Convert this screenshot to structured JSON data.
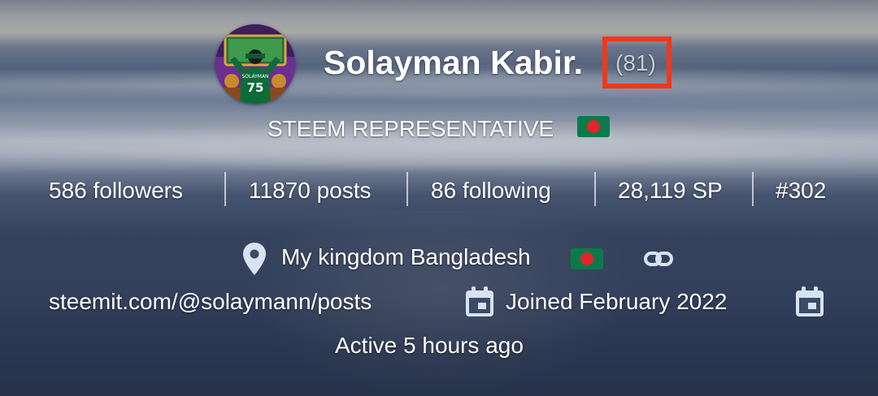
{
  "profile": {
    "name": "Solayman Kabir.",
    "reputation": "(81)",
    "tagline": "STEEM REPRESENTATIVE",
    "avatar_label": "SOLAYMAN",
    "avatar_number": "75"
  },
  "stats": {
    "followers": "586 followers",
    "posts": "11870 posts",
    "following": "86 following",
    "sp": "28,119 SP",
    "rank": "#302"
  },
  "info": {
    "location": "My kingdom Bangladesh",
    "website": "steemit.com/@solaymann/posts",
    "joined": "Joined February 2022",
    "active": "Active 5 hours ago"
  },
  "icons": {
    "location": "map-pin-icon",
    "link": "link-icon",
    "calendar": "calendar-icon",
    "flag": "bangladesh-flag-icon"
  },
  "colors": {
    "highlight_box": "#f0381b",
    "flag_green": "#0b7a4b",
    "flag_red": "#e4232b",
    "icon_fill": "#d8e2f0"
  }
}
